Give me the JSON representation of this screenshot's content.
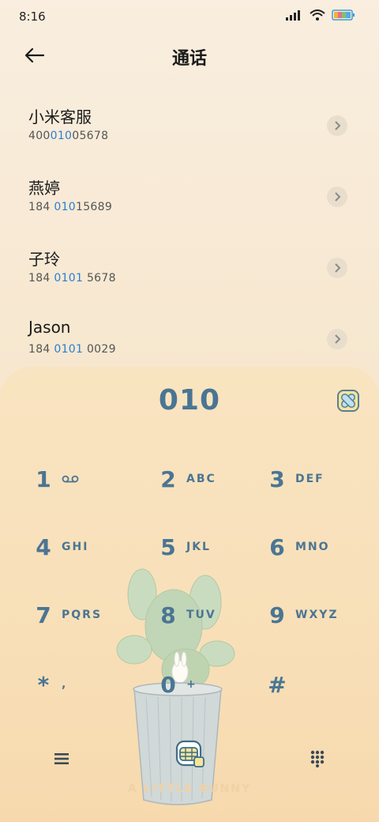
{
  "status": {
    "time": "8:16"
  },
  "header": {
    "title": "通话"
  },
  "contacts": [
    {
      "name": "小米客服",
      "num_pre": "400",
      "num_hl": "010",
      "num_post": "05678"
    },
    {
      "name": "燕婷",
      "num_pre": "184 ",
      "num_hl": "010",
      "num_post": "15689"
    },
    {
      "name": "子玲",
      "num_pre": "184 ",
      "num_hl": "0101",
      "num_post": " 5678"
    },
    {
      "name": "Jason",
      "num_pre": "184 ",
      "num_hl": "0101",
      "num_post": " 0029"
    }
  ],
  "dialpad": {
    "input": "010",
    "keys": [
      {
        "digit": "1",
        "letters": ""
      },
      {
        "digit": "2",
        "letters": "ABC"
      },
      {
        "digit": "3",
        "letters": "DEF"
      },
      {
        "digit": "4",
        "letters": "GHI"
      },
      {
        "digit": "5",
        "letters": "JKL"
      },
      {
        "digit": "6",
        "letters": "MNO"
      },
      {
        "digit": "7",
        "letters": "PQRS"
      },
      {
        "digit": "8",
        "letters": "TUV"
      },
      {
        "digit": "9",
        "letters": "WXYZ"
      },
      {
        "digit": "*",
        "letters": ","
      },
      {
        "digit": "0",
        "letters": "+"
      },
      {
        "digit": "#",
        "letters": ""
      }
    ],
    "watermark": "A LITTLE BUNNY"
  },
  "colors": {
    "accent": "#4a7593",
    "highlight": "#2a7fd2"
  }
}
